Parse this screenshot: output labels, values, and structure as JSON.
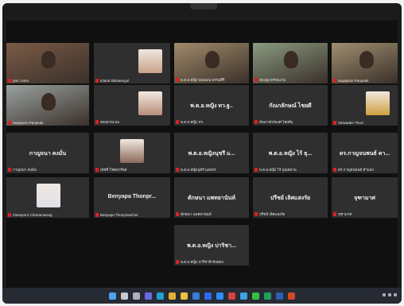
{
  "participants": [
    {
      "name": "pmc room",
      "kind": "video"
    },
    {
      "name": "tidarat kittisaengul",
      "kind": "thumb",
      "thumb_color": "#c9a08a"
    },
    {
      "name": "พ.ต.อ.หญิง บุณยมน ธรรมศิริ",
      "kind": "video"
    },
    {
      "name": "สมบุญ พรรณงาม",
      "kind": "video"
    },
    {
      "name": "Supaporn Panpeak",
      "kind": "video"
    },
    {
      "name": "Supaporn Panpeak",
      "kind": "video",
      "active": true
    },
    {
      "name": "ทองอาสะนบ",
      "kind": "thumb",
      "thumb_color": "#b98f7a"
    },
    {
      "name": "พ.ต.อ.หญิง ทว.",
      "center": "พ.ต.อ.หญิง ทว.ฐ..",
      "kind": "name"
    },
    {
      "name": "ทัณกาดังรองศ ไทยดีแ",
      "center": "กัณกลักษณ์ ไชยดี",
      "kind": "name"
    },
    {
      "name": "Siriwadee Thuzi",
      "kind": "thumb",
      "thumb_color": "#d0a040"
    },
    {
      "name": "กาญจนา คงมั่น",
      "center": "กาญจนา คงมั่น",
      "kind": "name"
    },
    {
      "name": "ณัชชิ โชคอาร์ทส",
      "kind": "thumb",
      "thumb_color": "#8b6a5a"
    },
    {
      "name": "พ.ต.อ.หญิงนุชรี แสงพร",
      "center": "พ.ต.อ.หญิงนุชรี แ...",
      "kind": "name"
    },
    {
      "name": "พ.ต.อ.หญิง ไร้ บุณยพาน",
      "center": "พ.ต.อ.หญิง ไร้ ธุ...",
      "kind": "name"
    },
    {
      "name": "ดร.กาญจนพนธ์ คำแสง",
      "center": "ดร.กาญจนพนธ์ คา...",
      "kind": "name"
    },
    {
      "name": "Zineeporn Charoenwong",
      "kind": "thumb",
      "thumb_color": "#e0e0e8"
    },
    {
      "name": "Benyapa Thonpravichet",
      "center": "Benyapa Thonpr...",
      "kind": "name"
    },
    {
      "name": "ตักษนา แพทยานันท์",
      "center": "ตักษนา แพทยานันท์",
      "kind": "name"
    },
    {
      "name": "ปรีชย์ เลิศแสงรัย",
      "center": "ปรีชย์ เลิศแสงรัย",
      "kind": "name"
    },
    {
      "name": "จุฑามาศ",
      "center": "จุฑามาศ",
      "kind": "name"
    },
    {
      "name": "พ.ต.อ.หญิง ปาริชาติ ทับทอง",
      "center": "พ.ต.อ.หญิง ปาริชา...",
      "kind": "name"
    }
  ],
  "taskbar": {
    "icons": [
      {
        "name": "windows-start-icon",
        "color": "#4aa3f0"
      },
      {
        "name": "search-icon",
        "color": "#c8c8d0"
      },
      {
        "name": "task-view-icon",
        "color": "#b0b0c0"
      },
      {
        "name": "chat-icon",
        "color": "#6a6ae0"
      },
      {
        "name": "edge-icon",
        "color": "#1fa0d0"
      },
      {
        "name": "chrome-icon",
        "color": "#e0b030"
      },
      {
        "name": "file-explorer-icon",
        "color": "#f0c040"
      },
      {
        "name": "store-icon",
        "color": "#3a7ad8"
      },
      {
        "name": "dropbox-icon",
        "color": "#2a6af0"
      },
      {
        "name": "zoom-icon",
        "color": "#2d8cff"
      },
      {
        "name": "app-icon-red",
        "color": "#d84040"
      },
      {
        "name": "photos-icon",
        "color": "#40a0e0"
      },
      {
        "name": "line-icon",
        "color": "#30c040"
      },
      {
        "name": "app-icon-green",
        "color": "#20a060"
      },
      {
        "name": "word-icon",
        "color": "#2b5fb8"
      },
      {
        "name": "powerpoint-icon",
        "color": "#d04a2a"
      }
    ]
  }
}
